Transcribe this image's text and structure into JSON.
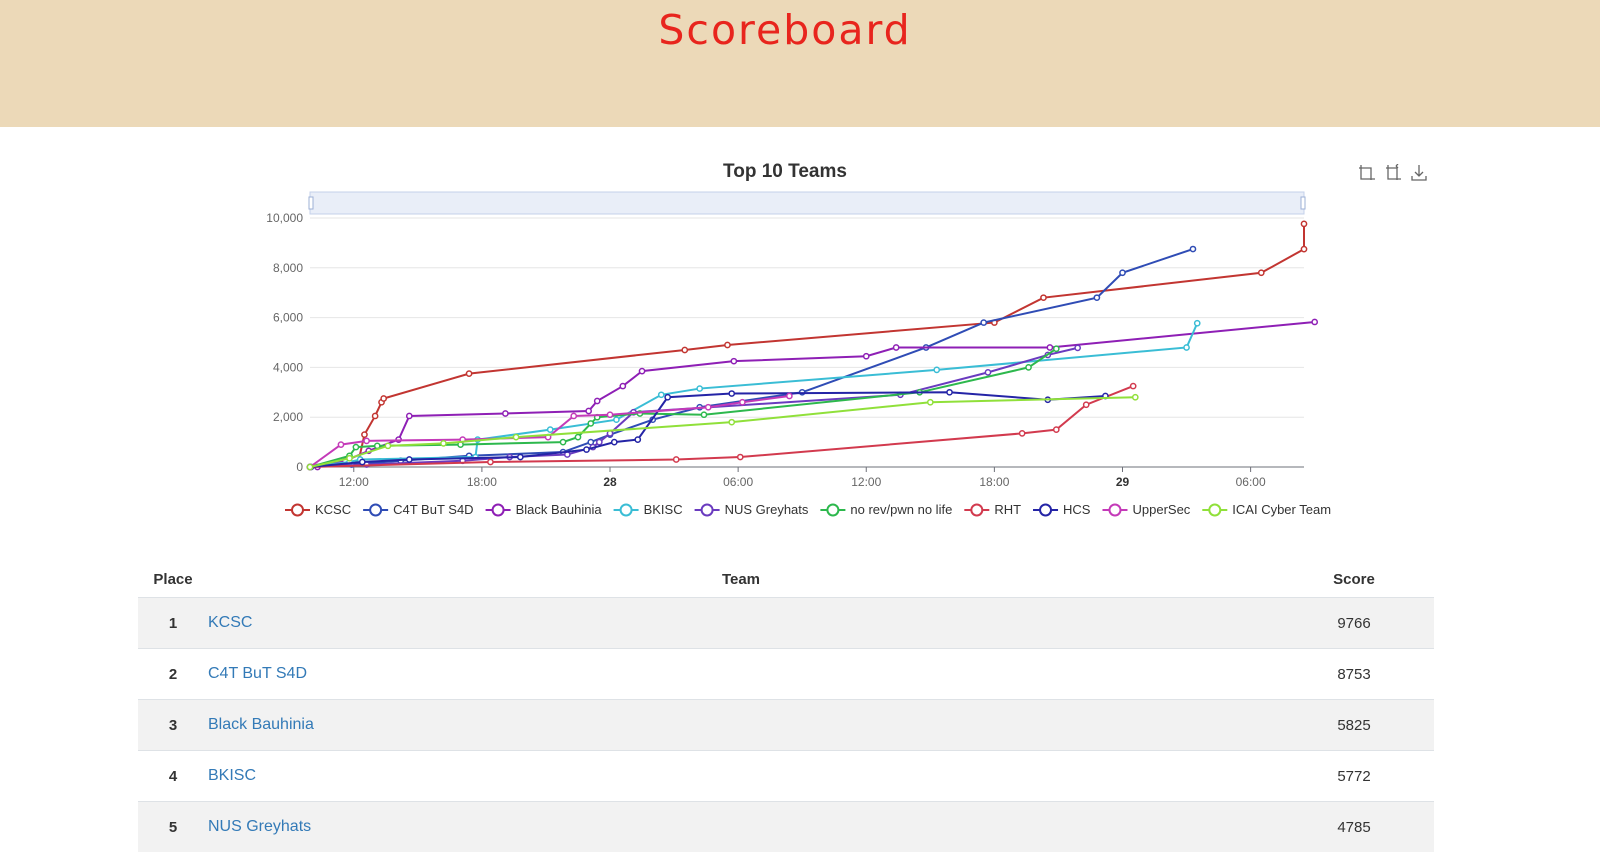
{
  "page": {
    "title": "Scoreboard"
  },
  "chart_data": {
    "type": "line",
    "title": "Top 10 Teams",
    "x_unit": "hours",
    "x_range": [
      3,
      31.2
    ],
    "x_ticks": [
      {
        "t": 9,
        "label": "12:00"
      },
      {
        "t": 15,
        "label": "18:00"
      },
      {
        "t": 21,
        "label": "28",
        "bold": true
      },
      {
        "t": 27,
        "label": "06:00"
      },
      {
        "t": 33,
        "label": "12:00"
      },
      {
        "t": 39,
        "label": "18:00"
      },
      {
        "t": 45,
        "label": "29",
        "bold": true
      },
      {
        "t": 51,
        "label": "06:00"
      }
    ],
    "ylim": [
      0,
      10000
    ],
    "y_ticks": [
      0,
      2000,
      4000,
      6000,
      8000,
      10000
    ],
    "y_tick_labels": [
      "0",
      "2,000",
      "4,000",
      "6,000",
      "8,000",
      "10,000"
    ],
    "legend_position": "bottom",
    "series": [
      {
        "name": "KCSC",
        "color": "#c23531",
        "points": [
          [
            6.95,
            0
          ],
          [
            9.2,
            150
          ],
          [
            9.5,
            1300
          ],
          [
            10,
            2050
          ],
          [
            10.3,
            2600
          ],
          [
            10.4,
            2750
          ],
          [
            14.4,
            3750
          ],
          [
            24.5,
            4700
          ],
          [
            26.5,
            4900
          ],
          [
            39,
            5800
          ],
          [
            41.3,
            6800
          ],
          [
            51.5,
            7800
          ],
          [
            53.5,
            8750
          ],
          [
            53.5,
            9766
          ]
        ]
      },
      {
        "name": "C4T BuT S4D",
        "color": "#2f4cb5",
        "points": [
          [
            7,
            0
          ],
          [
            8.9,
            100
          ],
          [
            11.2,
            250
          ],
          [
            14.4,
            450
          ],
          [
            18.8,
            600
          ],
          [
            20.1,
            1000
          ],
          [
            21,
            1300
          ],
          [
            23,
            1900
          ],
          [
            25.2,
            2400
          ],
          [
            30,
            3000
          ],
          [
            35.8,
            4800
          ],
          [
            38.5,
            5800
          ],
          [
            43.8,
            6800
          ],
          [
            45,
            7800
          ],
          [
            48.3,
            8753
          ]
        ]
      },
      {
        "name": "Black Bauhinia",
        "color": "#8e1fb5",
        "points": [
          [
            7.3,
            0
          ],
          [
            8.6,
            250
          ],
          [
            9.7,
            650
          ],
          [
            11.1,
            1100
          ],
          [
            11.6,
            2050
          ],
          [
            16.1,
            2150
          ],
          [
            20,
            2250
          ],
          [
            20.4,
            2650
          ],
          [
            21.6,
            3250
          ],
          [
            22.5,
            3850
          ],
          [
            26.8,
            4250
          ],
          [
            33,
            4450
          ],
          [
            34.4,
            4800
          ],
          [
            41.6,
            4800
          ],
          [
            54,
            5825
          ]
        ]
      },
      {
        "name": "BKISC",
        "color": "#3abdd5",
        "points": [
          [
            6.95,
            0
          ],
          [
            8.8,
            200
          ],
          [
            9.3,
            300
          ],
          [
            14.7,
            400
          ],
          [
            14.8,
            1100
          ],
          [
            18.2,
            1500
          ],
          [
            21.3,
            1900
          ],
          [
            23.4,
            2900
          ],
          [
            25.2,
            3150
          ],
          [
            36.3,
            3900
          ],
          [
            48,
            4800
          ],
          [
            48.5,
            5772
          ]
        ]
      },
      {
        "name": "NUS Greyhats",
        "color": "#6a3bbf",
        "points": [
          [
            6.95,
            0
          ],
          [
            9.6,
            100
          ],
          [
            14.1,
            250
          ],
          [
            16.3,
            400
          ],
          [
            19,
            500
          ],
          [
            20.2,
            800
          ],
          [
            20.5,
            1000
          ],
          [
            21,
            1350
          ],
          [
            22.1,
            2200
          ],
          [
            34.6,
            2900
          ],
          [
            38.7,
            3800
          ],
          [
            41.5,
            4500
          ],
          [
            42.9,
            4785
          ]
        ]
      },
      {
        "name": "no rev/pwn no life",
        "color": "#2db84d",
        "points": [
          [
            6.95,
            0
          ],
          [
            8.8,
            450
          ],
          [
            9.1,
            800
          ],
          [
            10.1,
            850
          ],
          [
            14,
            900
          ],
          [
            18.8,
            1000
          ],
          [
            19.5,
            1200
          ],
          [
            20.1,
            1750
          ],
          [
            20.4,
            2000
          ],
          [
            22.4,
            2150
          ],
          [
            25.4,
            2100
          ],
          [
            35.5,
            3000
          ],
          [
            40.6,
            4000
          ],
          [
            41.9,
            4750
          ]
        ]
      },
      {
        "name": "RHT",
        "color": "#d23a4e",
        "points": [
          [
            6.95,
            0
          ],
          [
            15.4,
            200
          ],
          [
            24.1,
            300
          ],
          [
            27.1,
            400
          ],
          [
            40.3,
            1350
          ],
          [
            41.9,
            1500
          ],
          [
            43.3,
            2500
          ],
          [
            45.5,
            3250
          ]
        ]
      },
      {
        "name": "HCS",
        "color": "#2424a6",
        "points": [
          [
            6.95,
            0
          ],
          [
            9.4,
            200
          ],
          [
            11.6,
            300
          ],
          [
            16.8,
            400
          ],
          [
            19.9,
            700
          ],
          [
            21.2,
            1000
          ],
          [
            22.3,
            1100
          ],
          [
            23.7,
            2800
          ],
          [
            26.7,
            2950
          ],
          [
            36.9,
            3000
          ],
          [
            41.5,
            2700
          ],
          [
            44.2,
            2850
          ]
        ]
      },
      {
        "name": "UpperSec",
        "color": "#c43ab8",
        "points": [
          [
            6.95,
            0
          ],
          [
            8.4,
            900
          ],
          [
            9.6,
            1050
          ],
          [
            14.1,
            1100
          ],
          [
            18.1,
            1200
          ],
          [
            19.3,
            2050
          ],
          [
            21,
            2100
          ],
          [
            25.6,
            2400
          ],
          [
            27.2,
            2600
          ],
          [
            29.4,
            2850
          ]
        ]
      },
      {
        "name": "ICAI Cyber Team",
        "color": "#90e03a",
        "points": [
          [
            6.95,
            0
          ],
          [
            8.8,
            350
          ],
          [
            10.6,
            850
          ],
          [
            13.2,
            950
          ],
          [
            16.6,
            1200
          ],
          [
            26.7,
            1800
          ],
          [
            36,
            2600
          ],
          [
            45.6,
            2800
          ]
        ]
      }
    ]
  },
  "toolbox": [
    {
      "name": "zoom-icon"
    },
    {
      "name": "zoom-reset-icon"
    },
    {
      "name": "download-icon"
    }
  ],
  "table": {
    "headers": {
      "place": "Place",
      "team": "Team",
      "score": "Score"
    },
    "rows": [
      {
        "place": "1",
        "team": "KCSC",
        "score": "9766"
      },
      {
        "place": "2",
        "team": "C4T BuT S4D",
        "score": "8753"
      },
      {
        "place": "3",
        "team": "Black Bauhinia",
        "score": "5825"
      },
      {
        "place": "4",
        "team": "BKISC",
        "score": "5772"
      },
      {
        "place": "5",
        "team": "NUS Greyhats",
        "score": "4785"
      }
    ]
  }
}
